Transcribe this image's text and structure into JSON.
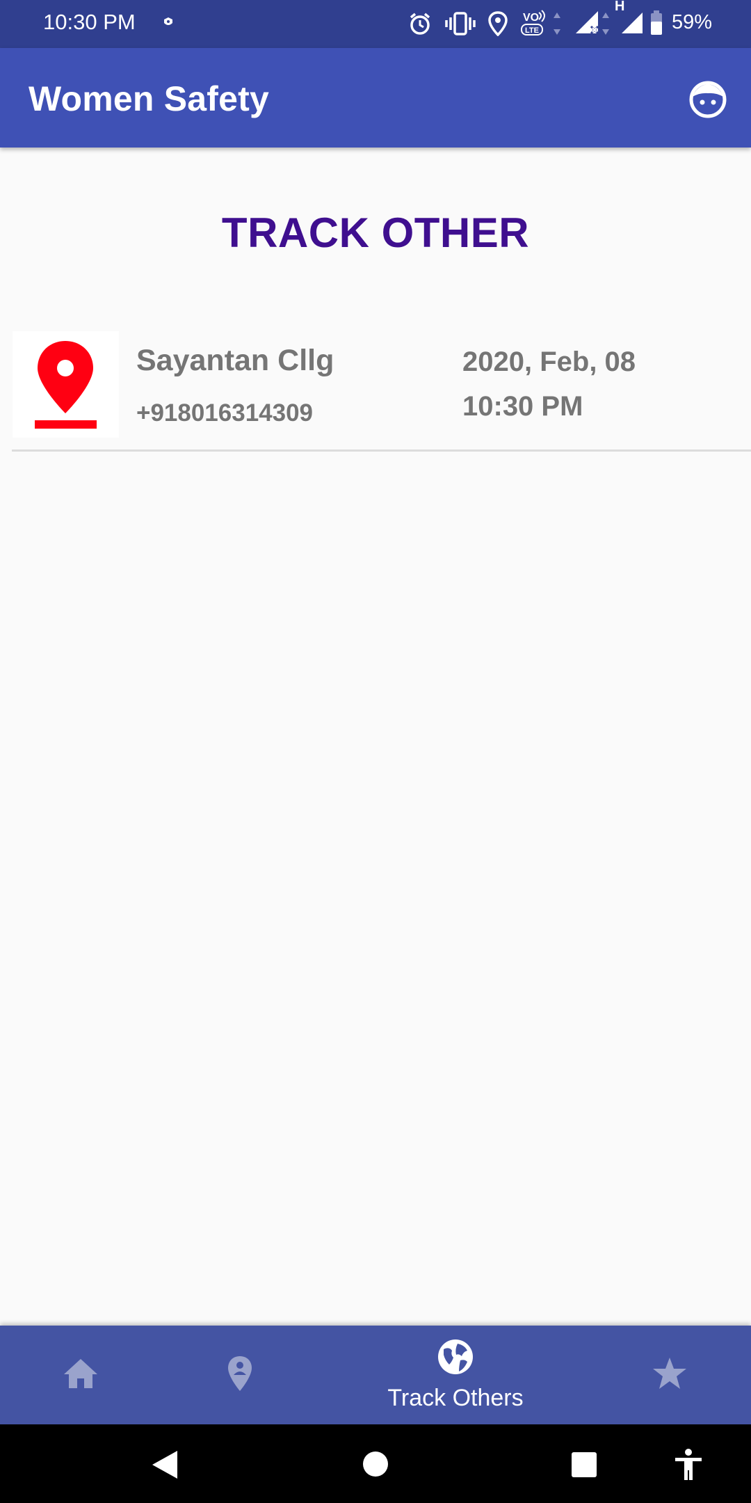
{
  "status_bar": {
    "time": "10:30 PM",
    "battery": "59%",
    "network_type": "H",
    "icons": [
      "vpn-key-icon",
      "alarm-icon",
      "vibrate-icon",
      "location-icon",
      "volte-icon",
      "signal-no-service-icon",
      "signal-icon",
      "battery-icon"
    ]
  },
  "app_bar": {
    "title": "Women Safety",
    "profile_icon": "face-icon"
  },
  "page": {
    "heading": "TRACK OTHER"
  },
  "track_list": [
    {
      "icon": "location-pin-icon",
      "name": "Sayantan Cllg",
      "phone": "+918016314309",
      "date": "2020, Feb, 08",
      "time": "10:30 PM"
    }
  ],
  "bottom_nav": {
    "items": [
      {
        "id": "home",
        "icon": "home-icon",
        "label": "",
        "active": false
      },
      {
        "id": "location",
        "icon": "person-pin-icon",
        "label": "",
        "active": false
      },
      {
        "id": "track_others",
        "icon": "globe-icon",
        "label": "Track Others",
        "active": true
      },
      {
        "id": "favorites",
        "icon": "star-icon",
        "label": "",
        "active": false
      }
    ]
  },
  "system_nav": {
    "buttons": [
      "back-icon",
      "home-circle-icon",
      "recents-icon",
      "accessibility-icon"
    ]
  },
  "colors": {
    "status_bar": "#303f8f",
    "app_bar": "#3f51b5",
    "bottom_nav": "#4454a3",
    "heading": "#3f0f8f",
    "pin": "#ff0012",
    "inactive_nav_icon": "#9aa3cc"
  }
}
